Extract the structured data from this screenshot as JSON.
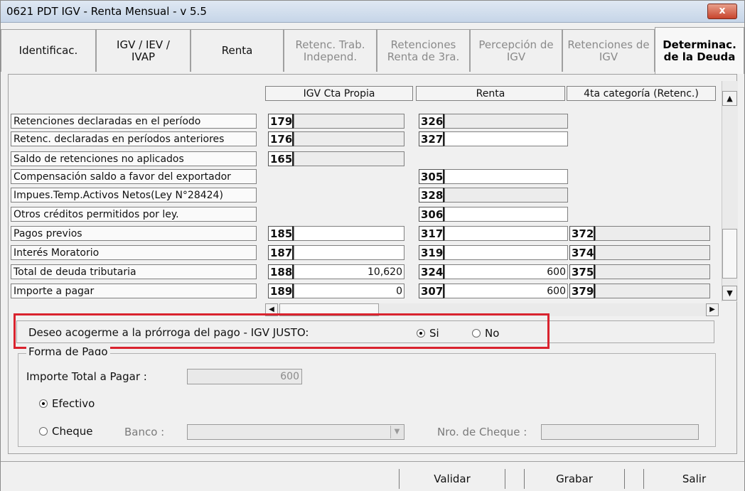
{
  "window": {
    "title": "0621 PDT IGV - Renta Mensual - v 5.5",
    "close_glyph": "x"
  },
  "tabs": [
    {
      "line1": "Identificac.",
      "line2": "",
      "state": "normal"
    },
    {
      "line1": "IGV / IEV /",
      "line2": "IVAP",
      "state": "normal"
    },
    {
      "line1": "Renta",
      "line2": "",
      "state": "normal"
    },
    {
      "line1": "Retenc. Trab.",
      "line2": "Independ.",
      "state": "disabled"
    },
    {
      "line1": "Retenciones",
      "line2": "Renta de 3ra.",
      "state": "disabled"
    },
    {
      "line1": "Percepción de",
      "line2": "IGV",
      "state": "disabled"
    },
    {
      "line1": "Retenciones de",
      "line2": "IGV",
      "state": "disabled"
    },
    {
      "line1": "Determinac.",
      "line2": "de la Deuda",
      "state": "active"
    }
  ],
  "grid": {
    "columns": [
      "IGV Cta Propia",
      "Renta",
      "4ta categoría (Retenc.)"
    ],
    "rows": [
      {
        "label": "Retenciones declaradas en el período",
        "c1": "179",
        "v1": "",
        "c2": "326",
        "v2": "",
        "c3": "",
        "v3": ""
      },
      {
        "label": "Retenc. declaradas en períodos anteriores",
        "c1": "176",
        "v1": "",
        "c2": "327",
        "v2": "",
        "c3": "",
        "v3": ""
      },
      {
        "label": "Saldo de retenciones no aplicados",
        "c1": "165",
        "v1": "",
        "c2": "",
        "v2": "",
        "c3": "",
        "v3": ""
      },
      {
        "label": "Compensación saldo a favor del exportador",
        "c1": "",
        "v1": "",
        "c2": "305",
        "v2": "",
        "c3": "",
        "v3": ""
      },
      {
        "label": "Impues.Temp.Activos Netos(Ley N°28424)",
        "c1": "",
        "v1": "",
        "c2": "328",
        "v2": "",
        "c3": "",
        "v3": ""
      },
      {
        "label": "Otros créditos permitidos por ley.",
        "c1": "",
        "v1": "",
        "c2": "306",
        "v2": "",
        "c3": "",
        "v3": ""
      },
      {
        "label": "Pagos previos",
        "c1": "185",
        "v1": "",
        "c2": "317",
        "v2": "",
        "c3": "372",
        "v3": ""
      },
      {
        "label": "Interés Moratorio",
        "c1": "187",
        "v1": "",
        "c2": "319",
        "v2": "",
        "c3": "374",
        "v3": ""
      },
      {
        "label": "Total de deuda tributaria",
        "c1": "188",
        "v1": "10,620",
        "c2": "324",
        "v2": "600",
        "c3": "375",
        "v3": ""
      },
      {
        "label": "Importe a pagar",
        "c1": "189",
        "v1": "0",
        "c2": "307",
        "v2": "600",
        "c3": "379",
        "v3": ""
      }
    ]
  },
  "prorroga": {
    "label": "Deseo acogerme a la prórroga del pago - IGV JUSTO:",
    "option_si": "Si",
    "option_no": "No",
    "selected": "Si"
  },
  "forma_pago": {
    "legend": "Forma de Pago",
    "importe_label": "Importe Total a Pagar :",
    "importe_value": "600",
    "efectivo_label": "Efectivo",
    "cheque_label": "Cheque",
    "selected": "Efectivo",
    "banco_label": "Banco :",
    "banco_value": "",
    "nro_cheque_label": "Nro. de Cheque :",
    "nro_cheque_value": ""
  },
  "buttons": {
    "validar": "Validar",
    "grabar": "Grabar",
    "salir": "Salir"
  },
  "icons": {
    "scroll_up": "▲",
    "scroll_down": "▼",
    "scroll_left": "◀",
    "scroll_right": "▶",
    "dropdown": "▼"
  }
}
